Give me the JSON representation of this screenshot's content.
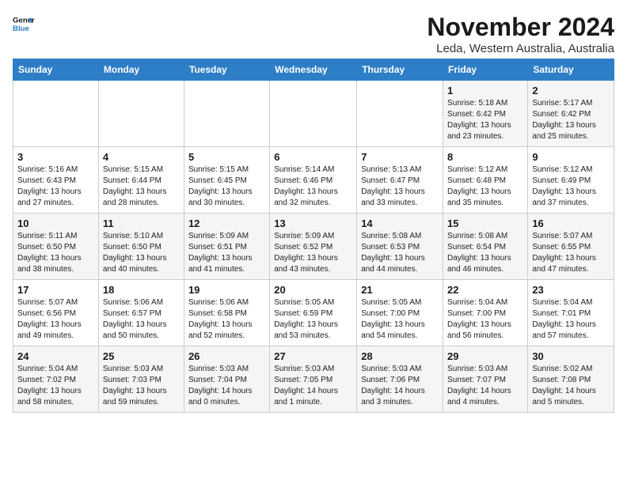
{
  "logo": {
    "line1": "General",
    "line2": "Blue"
  },
  "title": "November 2024",
  "subtitle": "Leda, Western Australia, Australia",
  "days_of_week": [
    "Sunday",
    "Monday",
    "Tuesday",
    "Wednesday",
    "Thursday",
    "Friday",
    "Saturday"
  ],
  "weeks": [
    [
      {
        "day": "",
        "info": ""
      },
      {
        "day": "",
        "info": ""
      },
      {
        "day": "",
        "info": ""
      },
      {
        "day": "",
        "info": ""
      },
      {
        "day": "",
        "info": ""
      },
      {
        "day": "1",
        "info": "Sunrise: 5:18 AM\nSunset: 6:42 PM\nDaylight: 13 hours\nand 23 minutes."
      },
      {
        "day": "2",
        "info": "Sunrise: 5:17 AM\nSunset: 6:42 PM\nDaylight: 13 hours\nand 25 minutes."
      }
    ],
    [
      {
        "day": "3",
        "info": "Sunrise: 5:16 AM\nSunset: 6:43 PM\nDaylight: 13 hours\nand 27 minutes."
      },
      {
        "day": "4",
        "info": "Sunrise: 5:15 AM\nSunset: 6:44 PM\nDaylight: 13 hours\nand 28 minutes."
      },
      {
        "day": "5",
        "info": "Sunrise: 5:15 AM\nSunset: 6:45 PM\nDaylight: 13 hours\nand 30 minutes."
      },
      {
        "day": "6",
        "info": "Sunrise: 5:14 AM\nSunset: 6:46 PM\nDaylight: 13 hours\nand 32 minutes."
      },
      {
        "day": "7",
        "info": "Sunrise: 5:13 AM\nSunset: 6:47 PM\nDaylight: 13 hours\nand 33 minutes."
      },
      {
        "day": "8",
        "info": "Sunrise: 5:12 AM\nSunset: 6:48 PM\nDaylight: 13 hours\nand 35 minutes."
      },
      {
        "day": "9",
        "info": "Sunrise: 5:12 AM\nSunset: 6:49 PM\nDaylight: 13 hours\nand 37 minutes."
      }
    ],
    [
      {
        "day": "10",
        "info": "Sunrise: 5:11 AM\nSunset: 6:50 PM\nDaylight: 13 hours\nand 38 minutes."
      },
      {
        "day": "11",
        "info": "Sunrise: 5:10 AM\nSunset: 6:50 PM\nDaylight: 13 hours\nand 40 minutes."
      },
      {
        "day": "12",
        "info": "Sunrise: 5:09 AM\nSunset: 6:51 PM\nDaylight: 13 hours\nand 41 minutes."
      },
      {
        "day": "13",
        "info": "Sunrise: 5:09 AM\nSunset: 6:52 PM\nDaylight: 13 hours\nand 43 minutes."
      },
      {
        "day": "14",
        "info": "Sunrise: 5:08 AM\nSunset: 6:53 PM\nDaylight: 13 hours\nand 44 minutes."
      },
      {
        "day": "15",
        "info": "Sunrise: 5:08 AM\nSunset: 6:54 PM\nDaylight: 13 hours\nand 46 minutes."
      },
      {
        "day": "16",
        "info": "Sunrise: 5:07 AM\nSunset: 6:55 PM\nDaylight: 13 hours\nand 47 minutes."
      }
    ],
    [
      {
        "day": "17",
        "info": "Sunrise: 5:07 AM\nSunset: 6:56 PM\nDaylight: 13 hours\nand 49 minutes."
      },
      {
        "day": "18",
        "info": "Sunrise: 5:06 AM\nSunset: 6:57 PM\nDaylight: 13 hours\nand 50 minutes."
      },
      {
        "day": "19",
        "info": "Sunrise: 5:06 AM\nSunset: 6:58 PM\nDaylight: 13 hours\nand 52 minutes."
      },
      {
        "day": "20",
        "info": "Sunrise: 5:05 AM\nSunset: 6:59 PM\nDaylight: 13 hours\nand 53 minutes."
      },
      {
        "day": "21",
        "info": "Sunrise: 5:05 AM\nSunset: 7:00 PM\nDaylight: 13 hours\nand 54 minutes."
      },
      {
        "day": "22",
        "info": "Sunrise: 5:04 AM\nSunset: 7:00 PM\nDaylight: 13 hours\nand 56 minutes."
      },
      {
        "day": "23",
        "info": "Sunrise: 5:04 AM\nSunset: 7:01 PM\nDaylight: 13 hours\nand 57 minutes."
      }
    ],
    [
      {
        "day": "24",
        "info": "Sunrise: 5:04 AM\nSunset: 7:02 PM\nDaylight: 13 hours\nand 58 minutes."
      },
      {
        "day": "25",
        "info": "Sunrise: 5:03 AM\nSunset: 7:03 PM\nDaylight: 13 hours\nand 59 minutes."
      },
      {
        "day": "26",
        "info": "Sunrise: 5:03 AM\nSunset: 7:04 PM\nDaylight: 14 hours\nand 0 minutes."
      },
      {
        "day": "27",
        "info": "Sunrise: 5:03 AM\nSunset: 7:05 PM\nDaylight: 14 hours\nand 1 minute."
      },
      {
        "day": "28",
        "info": "Sunrise: 5:03 AM\nSunset: 7:06 PM\nDaylight: 14 hours\nand 3 minutes."
      },
      {
        "day": "29",
        "info": "Sunrise: 5:03 AM\nSunset: 7:07 PM\nDaylight: 14 hours\nand 4 minutes."
      },
      {
        "day": "30",
        "info": "Sunrise: 5:02 AM\nSunset: 7:08 PM\nDaylight: 14 hours\nand 5 minutes."
      }
    ]
  ]
}
